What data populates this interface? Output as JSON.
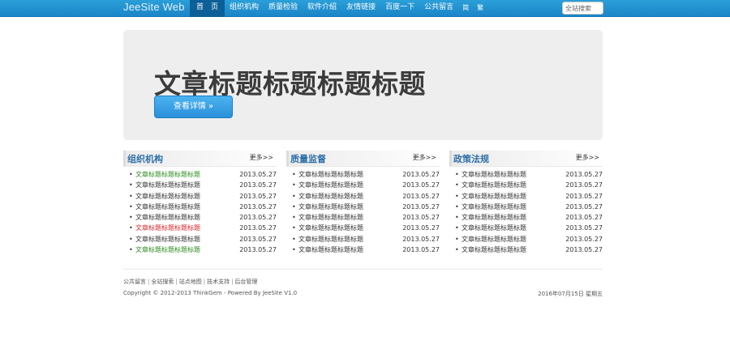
{
  "header": {
    "brand": "JeeSite Web",
    "nav": [
      {
        "label": "首　页",
        "active": true
      },
      {
        "label": "组织机构",
        "active": false
      },
      {
        "label": "质量检验",
        "active": false
      },
      {
        "label": "软件介绍",
        "active": false
      },
      {
        "label": "友情链接",
        "active": false
      },
      {
        "label": "百度一下",
        "active": false
      },
      {
        "label": "公共留言",
        "active": false
      }
    ],
    "lang_links": [
      "简",
      "繁"
    ],
    "search_placeholder": "全站搜索"
  },
  "hero": {
    "title": "文章标题标题标题标题",
    "button_label": "查看详情 »",
    "button_color": "#2a8fd9"
  },
  "columns": [
    {
      "title": "组织机构",
      "more": "更多>>",
      "items": [
        {
          "title": "文章标题标题标题标题",
          "date": "2013.05.27",
          "color": "#2e8b1f"
        },
        {
          "title": "文章标题标题标题标题",
          "date": "2013.05.27",
          "color": "#333333"
        },
        {
          "title": "文章标题标题标题标题",
          "date": "2013.05.27",
          "color": "#333333"
        },
        {
          "title": "文章标题标题标题标题",
          "date": "2013.05.27",
          "color": "#333333"
        },
        {
          "title": "文章标题标题标题标题",
          "date": "2013.05.27",
          "color": "#333333"
        },
        {
          "title": "文章标题标题标题标题",
          "date": "2013.05.27",
          "color": "#d8262a"
        },
        {
          "title": "文章标题标题标题标题",
          "date": "2013.05.27",
          "color": "#333333"
        },
        {
          "title": "文章标题标题标题标题",
          "date": "2013.05.27",
          "color": "#2e8b1f"
        }
      ]
    },
    {
      "title": "质量监督",
      "more": "更多>>",
      "items": [
        {
          "title": "文章标题标题标题标题",
          "date": "2013.05.27",
          "color": "#333333"
        },
        {
          "title": "文章标题标题标题标题",
          "date": "2013.05.27",
          "color": "#333333"
        },
        {
          "title": "文章标题标题标题标题",
          "date": "2013.05.27",
          "color": "#333333"
        },
        {
          "title": "文章标题标题标题标题",
          "date": "2013.05.27",
          "color": "#333333"
        },
        {
          "title": "文章标题标题标题标题",
          "date": "2013.05.27",
          "color": "#333333"
        },
        {
          "title": "文章标题标题标题标题",
          "date": "2013.05.27",
          "color": "#333333"
        },
        {
          "title": "文章标题标题标题标题",
          "date": "2013.05.27",
          "color": "#333333"
        },
        {
          "title": "文章标题标题标题标题",
          "date": "2013.05.27",
          "color": "#333333"
        }
      ]
    },
    {
      "title": "政策法规",
      "more": "更多>>",
      "items": [
        {
          "title": "文章标题标题标题标题",
          "date": "2013.05.27",
          "color": "#333333"
        },
        {
          "title": "文章标题标题标题标题",
          "date": "2013.05.27",
          "color": "#333333"
        },
        {
          "title": "文章标题标题标题标题",
          "date": "2013.05.27",
          "color": "#333333"
        },
        {
          "title": "文章标题标题标题标题",
          "date": "2013.05.27",
          "color": "#333333"
        },
        {
          "title": "文章标题标题标题标题",
          "date": "2013.05.27",
          "color": "#333333"
        },
        {
          "title": "文章标题标题标题标题",
          "date": "2013.05.27",
          "color": "#333333"
        },
        {
          "title": "文章标题标题标题标题",
          "date": "2013.05.27",
          "color": "#333333"
        },
        {
          "title": "文章标题标题标题标题",
          "date": "2013.05.27",
          "color": "#333333"
        }
      ]
    }
  ],
  "footer": {
    "links": [
      "公共留言",
      "全站搜索",
      "站点地图",
      "技术支持",
      "后台管理"
    ],
    "copyright": "Copyright © 2012-2013 ThinkGem - Powered By JeeSite V1.0",
    "date": "2016年07月15日 星期五"
  }
}
